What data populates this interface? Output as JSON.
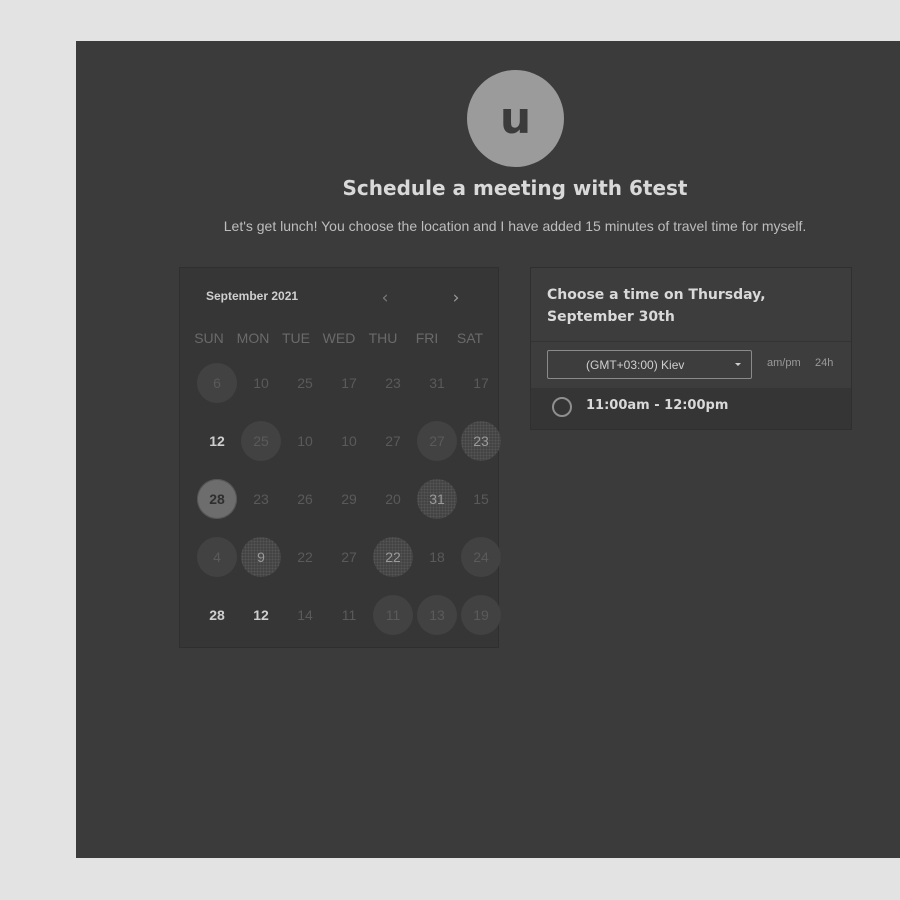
{
  "header": {
    "avatar_letter": "u",
    "title": "Schedule a meeting with 6test",
    "description": "Let's get lunch! You choose the location and I have added 15 minutes of travel time for myself."
  },
  "calendar": {
    "month_label": "September 2021",
    "prev_icon": "chevron-left-icon",
    "next_icon": "chevron-right-icon",
    "prev_glyph": "‹",
    "next_glyph": "›",
    "weekdays": [
      "SUN",
      "MON",
      "TUE",
      "WED",
      "THU",
      "FRI",
      "SAT"
    ],
    "weeks": [
      [
        "6",
        "10",
        "25",
        "17",
        "23",
        "31",
        "17"
      ],
      [
        "12",
        "25",
        "10",
        "10",
        "27",
        "27",
        "23"
      ],
      [
        "28",
        "23",
        "26",
        "29",
        "20",
        "31",
        "15"
      ],
      [
        "4",
        "9",
        "22",
        "27",
        "22",
        "18",
        "24"
      ],
      [
        "28",
        "12",
        "14",
        "11",
        "11",
        "13",
        "19"
      ]
    ]
  },
  "times": {
    "header": "Choose a time on Thursday, September 30th",
    "timezone": "(GMT+03:00) Kiev",
    "format_12h": "am/pm",
    "format_24h": "24h",
    "slots": [
      "11:00am - 12:00pm"
    ]
  },
  "colors": {
    "background": "#e3e3e3",
    "panel": "#3b3b3b",
    "avatar": "#9b9b9b"
  }
}
